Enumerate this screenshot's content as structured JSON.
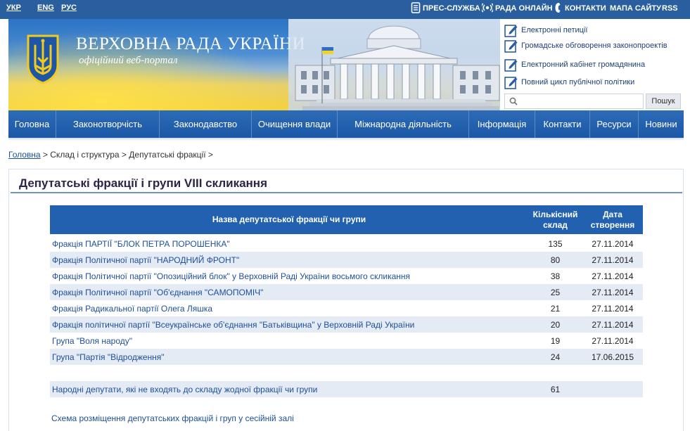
{
  "topbar": {
    "languages": [
      "УКР",
      "ENG",
      "РУС"
    ],
    "links": [
      {
        "label": "ПРЕС-СЛУЖБА",
        "icon": "document-icon"
      },
      {
        "label": "РАДА ОНЛАЙН",
        "icon": "broadcast-icon"
      },
      {
        "label": "КОНТАКТИ",
        "icon": "phone-icon"
      },
      {
        "label": "МАПА САЙТУ",
        "icon": ""
      },
      {
        "label": "RSS",
        "icon": ""
      }
    ]
  },
  "header": {
    "title": "ВЕРХОВНА РАДА УКРАЇНИ",
    "subtitle": "офіційний веб-портал",
    "panel_links": [
      "Електронні петиції",
      "Громадське обговорення законопроектів",
      "Електронний кабінет громадянина",
      "Повний цикл публічної політики"
    ],
    "search": {
      "placeholder": "",
      "value": "",
      "button_label": "Пошук"
    }
  },
  "nav": {
    "items": [
      "Головна",
      "Законотворчість",
      "Законодавство",
      "Очищення влади",
      "Міжнародна діяльність",
      "Інформація",
      "Контакти",
      "Ресурси",
      "Новини"
    ]
  },
  "breadcrumb": {
    "home": "Головна",
    "rest": " > Склад і структура > Депутатські фракції >"
  },
  "page": {
    "title": "Депутатські фракції і групи VIII скликання",
    "table": {
      "headers": {
        "name": "Назва депутатської фракції чи групи",
        "count": "Кількісний склад",
        "date": "Дата створення"
      },
      "rows": [
        {
          "name": "Фракція ПАРТІЇ \"БЛОК ПЕТРА ПОРОШЕНКА\"",
          "count": "135",
          "date": "27.11.2014"
        },
        {
          "name": "Фракція Політичної партії \"НАРОДНИЙ ФРОНТ\"",
          "count": "80",
          "date": "27.11.2014"
        },
        {
          "name": "Фракція Політичної партії \"Опозиційний блок\" у Верховній Раді України восьмого скликання",
          "count": "38",
          "date": "27.11.2014"
        },
        {
          "name": "Фракція Політичної партії \"Об'єднання \"САМОПОМІЧ\"",
          "count": "25",
          "date": "27.11.2014"
        },
        {
          "name": "Фракція Радикальної партії Олега Ляшка",
          "count": "21",
          "date": "27.11.2014"
        },
        {
          "name": "Фракція політичної партії \"Всеукраїнське об'єднання \"Батьківщина\" у Верховній Раді України",
          "count": "20",
          "date": "27.11.2014"
        },
        {
          "name": "Група \"Воля народу\"",
          "count": "19",
          "date": "27.11.2014"
        },
        {
          "name": "Група \"Партія \"Відродження\"",
          "count": "24",
          "date": "17.06.2015"
        }
      ],
      "independent": {
        "name": "Народні депутати, які не входять до складу жодної фракції чи групи",
        "count": "61",
        "date": ""
      }
    },
    "scheme_link": "Схема розміщення депутатських фракцій і груп у сесійній залі"
  },
  "colors": {
    "topbar": "#2a5f9f",
    "nav": "#1b57a5",
    "table_header": "#2161b0",
    "row_alt": "#e4ebf4",
    "link": "#1d4f9a",
    "title": "#2d2447"
  }
}
